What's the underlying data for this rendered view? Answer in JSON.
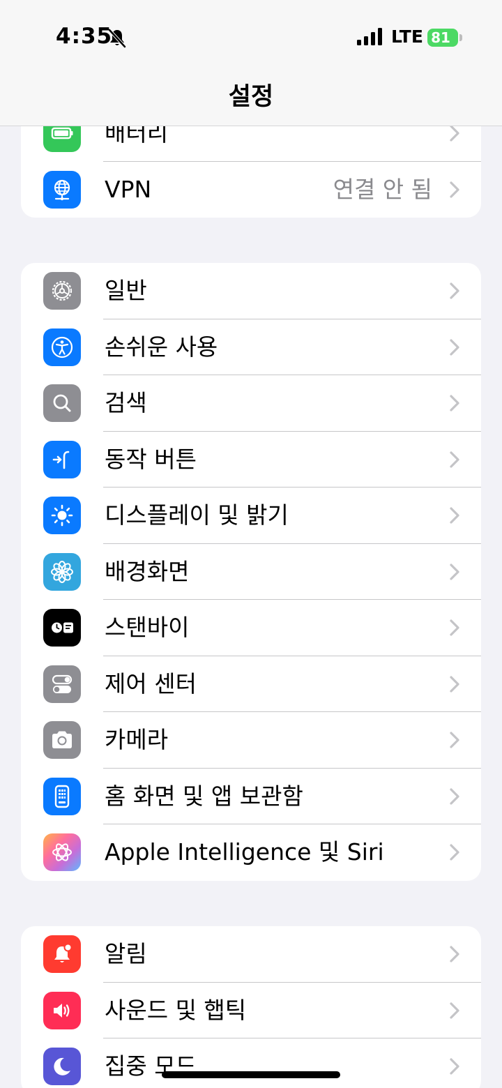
{
  "status": {
    "time": "4:35",
    "network": "LTE",
    "battery": "81"
  },
  "nav": {
    "title": "설정"
  },
  "group1": [
    {
      "label": "배터리",
      "value": "",
      "icon": "battery-icon",
      "color": "#34c759"
    },
    {
      "label": "VPN",
      "value": "연결 안 됨",
      "icon": "vpn-globe-icon",
      "color": "#0a7aff"
    }
  ],
  "group2": [
    {
      "label": "일반",
      "icon": "gear-icon",
      "color": "#8e8e93"
    },
    {
      "label": "손쉬운 사용",
      "icon": "accessibility-icon",
      "color": "#0a7aff"
    },
    {
      "label": "검색",
      "icon": "search-icon",
      "color": "#8e8e93"
    },
    {
      "label": "동작 버튼",
      "icon": "action-button-icon",
      "color": "#0a7aff"
    },
    {
      "label": "디스플레이 및 밝기",
      "icon": "sun-icon",
      "color": "#0a7aff"
    },
    {
      "label": "배경화면",
      "icon": "flower-icon",
      "color": "#33a6de"
    },
    {
      "label": "스탠바이",
      "icon": "standby-icon",
      "color": "#000000"
    },
    {
      "label": "제어 센터",
      "icon": "toggles-icon",
      "color": "#8e8e93"
    },
    {
      "label": "카메라",
      "icon": "camera-icon",
      "color": "#8e8e93"
    },
    {
      "label": "홈 화면 및 앱 보관함",
      "icon": "home-screen-icon",
      "color": "#0a7aff"
    },
    {
      "label": "Apple Intelligence 및 Siri",
      "icon": "apple-intelligence-icon",
      "color": "#e8a0d8"
    }
  ],
  "group3": [
    {
      "label": "알림",
      "icon": "notification-bell-icon",
      "color": "#ff3b30"
    },
    {
      "label": "사운드 및 햅틱",
      "icon": "speaker-icon",
      "color": "#ff2d55"
    },
    {
      "label": "집중 모드",
      "icon": "moon-icon",
      "color": "#5856d6"
    }
  ]
}
